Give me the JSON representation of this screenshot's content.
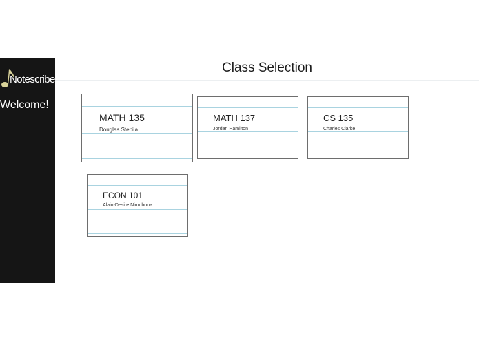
{
  "sidebar": {
    "logo_text": "Notescribe",
    "welcome": "Welcome!"
  },
  "header": {
    "title": "Class Selection"
  },
  "classes": [
    {
      "course": "MATH 135",
      "instructor": "Douglas Stebila"
    },
    {
      "course": "MATH 137",
      "instructor": "Jordan Hamilton"
    },
    {
      "course": "CS 135",
      "instructor": "Charles Clarke"
    },
    {
      "course": "ECON 101",
      "instructor": "Alain-Desire Nimubona"
    }
  ],
  "colors": {
    "sidebar_bg": "#151515",
    "logo_note": "#d9d39a",
    "card_rule": "#a9d3e0"
  }
}
